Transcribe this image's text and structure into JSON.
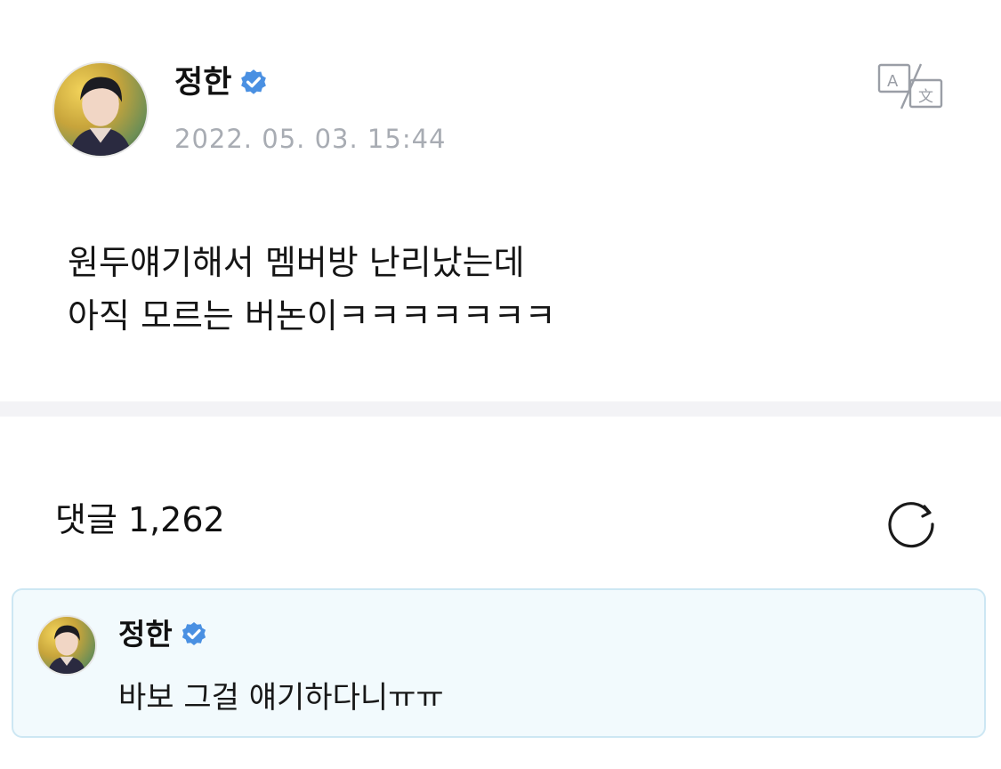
{
  "post": {
    "author": {
      "name": "정한",
      "verified": true,
      "avatar": "profile-photo"
    },
    "timestamp": "2022. 05. 03. 15:44",
    "translate_icon": "translate-icon",
    "body_lines": [
      "원두얘기해서 멤버방 난리났는데",
      "아직 모르는 버논이ㅋㅋㅋㅋㅋㅋㅋ"
    ]
  },
  "comments": {
    "label": "댓글",
    "count": "1,262",
    "refresh_icon": "refresh-icon",
    "items": [
      {
        "author": "정한",
        "verified": true,
        "text": "바보 그걸 얘기하다니ㅠㅠ"
      }
    ]
  },
  "colors": {
    "verified_badge": "#4a90e2",
    "timestamp": "#a8acb3",
    "comment_bg": "#f2fafd",
    "comment_border": "#cde7f3",
    "divider": "#f3f3f6"
  }
}
